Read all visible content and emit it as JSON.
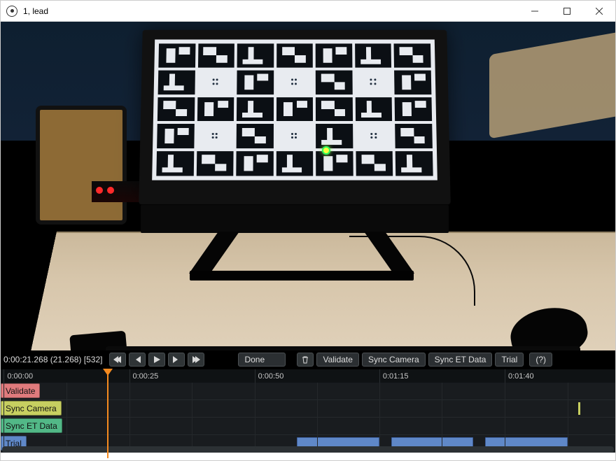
{
  "window": {
    "title": "1, lead"
  },
  "transport": {
    "timecode": "0:00:21.268 (21.268) [532]",
    "done_label": "Done",
    "buttons": {
      "validate": "Validate",
      "sync_camera": "Sync Camera",
      "sync_et_data": "Sync ET Data",
      "trial": "Trial"
    },
    "help_label": "(?)"
  },
  "ruler": {
    "ticks": [
      {
        "label": "0:00:00",
        "pos_pct": 0.5
      },
      {
        "label": "0:00:25",
        "pos_pct": 20.9
      },
      {
        "label": "0:00:50",
        "pos_pct": 41.3
      },
      {
        "label": "0:01:15",
        "pos_pct": 61.6
      },
      {
        "label": "0:01:40",
        "pos_pct": 82.0
      }
    ],
    "minor_grid_pct": [
      10.7,
      31.1,
      51.5,
      71.8,
      92.2
    ],
    "playhead_pct": 17.3
  },
  "tracks": {
    "validate": {
      "label": "Validate"
    },
    "sync_camera": {
      "label": "Sync Camera",
      "markers_pct": [
        94.0
      ]
    },
    "sync_et_data": {
      "label": "Sync ET Data"
    },
    "trial": {
      "label": "Trial",
      "clips": [
        {
          "start_pct": 48.2,
          "width_pct": 13.4
        },
        {
          "start_pct": 63.5,
          "width_pct": 13.4
        },
        {
          "start_pct": 78.8,
          "width_pct": 13.4
        }
      ]
    }
  },
  "colors": {
    "validate": "#e07b7d",
    "sync_camera": "#c7cf60",
    "sync_et_data": "#52b887",
    "trial": "#5f88c8",
    "playhead": "#f58a1f"
  }
}
